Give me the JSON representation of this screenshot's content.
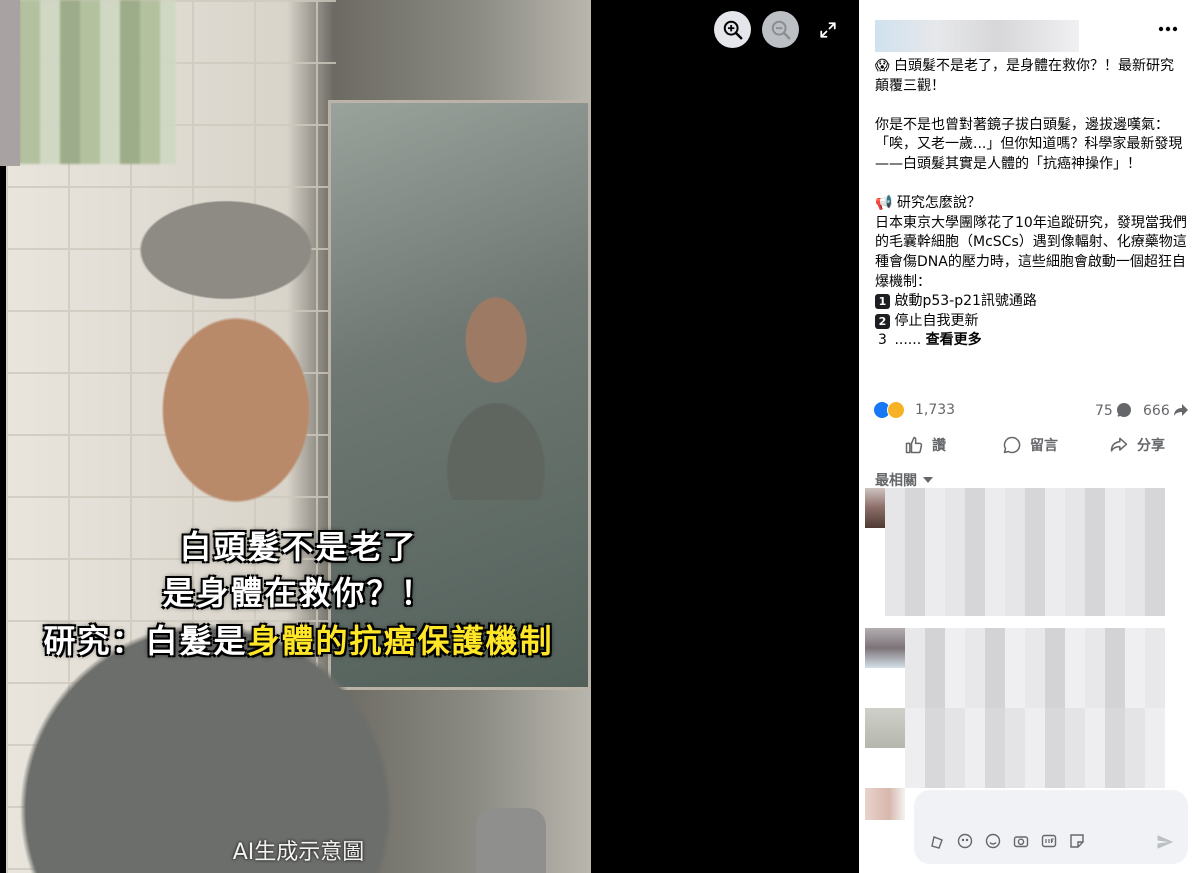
{
  "viewer": {
    "image_caption": {
      "line1": "白頭髮不是老了",
      "line2": "是身體在救你？！",
      "line3_plain": "研究：白髮是",
      "line3_highlight": "身體的抗癌保護機制"
    },
    "ai_note": "AI生成示意圖",
    "controls": {
      "zoom_in_icon": "zoom-in-icon",
      "zoom_out_icon": "zoom-out-icon",
      "fullscreen_icon": "fullscreen-icon"
    }
  },
  "post": {
    "more_icon": "more-icon",
    "text": {
      "p1_emoji": "😱",
      "p1": " 白頭髮不是老了，是身體在救你？！最新研究顛覆三觀！",
      "p2": "你是不是也曾對著鏡子拔白頭髮，邊拔邊嘆氣：「唉，又老一歲...」但你知道嗎？科學家最新發現——白頭髮其實是人體的「抗癌神操作」！",
      "p3_emoji": "📢",
      "p3_title": " 研究怎麼說？",
      "p3_body": "日本東京大學團隊花了10年追蹤研究，發現當我們的毛囊幹細胞（McSCs）遇到像輻射、化療藥物這種會傷DNA的壓力時，這些細胞會啟動一個超狂自爆機制：",
      "item1_num": "1",
      "item1": " 啟動p53-p21訊號通路",
      "item2_num": "2",
      "item2": " 停止自我更新",
      "item3_num": "3",
      "item3": " ...... ",
      "see_more": "查看更多"
    },
    "reactions": {
      "count": "1,733",
      "comments": "75",
      "shares": "666"
    },
    "actions": {
      "like": "讚",
      "comment": "留言",
      "share": "分享"
    },
    "sort_label": "最相關"
  },
  "colors": {
    "highlight": "#ffe626",
    "like_blue": "#1877f2",
    "wow_yellow": "#f7b125"
  }
}
